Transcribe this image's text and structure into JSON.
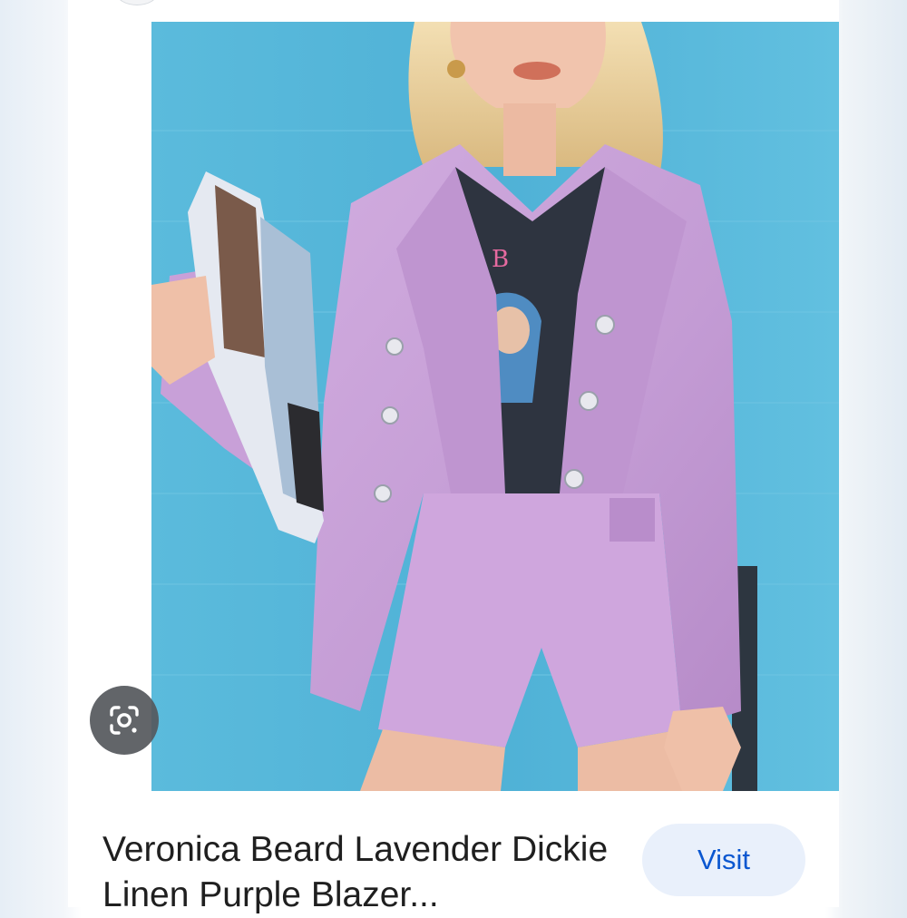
{
  "result": {
    "title": "Veronica Beard Lavender Dickie Linen Purple Blazer...",
    "visit_label": "Visit"
  },
  "image": {
    "alt": "Veronica Beard Lavender Dickie Linen Purple Blazer"
  },
  "icons": {
    "lens": "google-lens-icon"
  },
  "colors": {
    "background_wall": "#57b5d7",
    "blazer": "#c9a2d8",
    "visit_text": "#0b57d0",
    "visit_bg": "#e9f0fb",
    "title_text": "#1f1f1f"
  }
}
